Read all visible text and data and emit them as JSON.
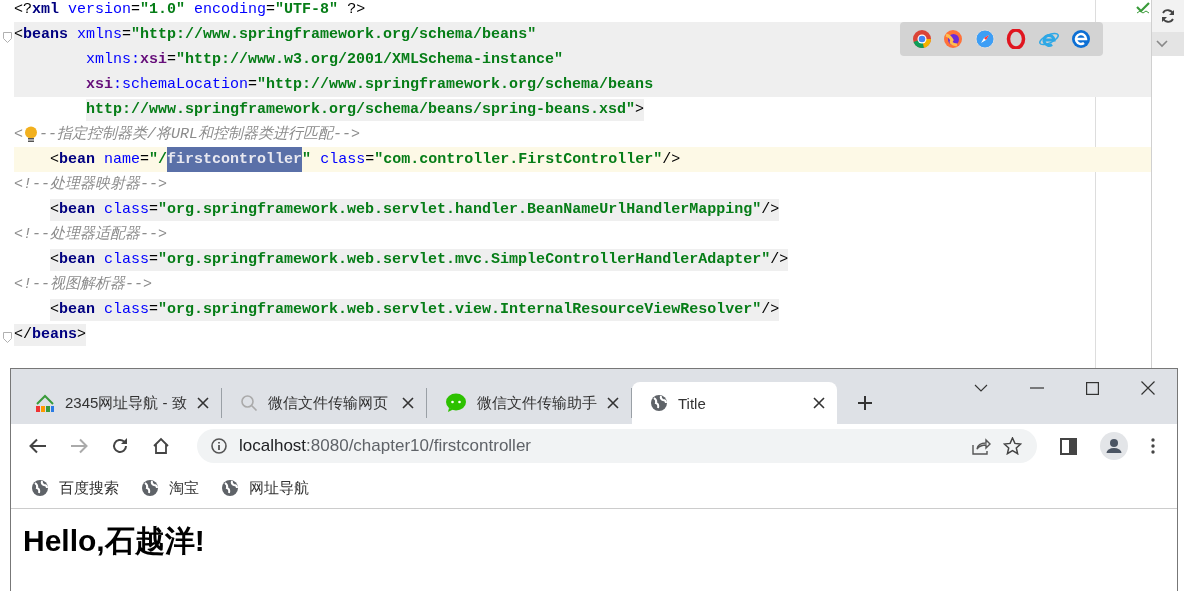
{
  "editor": {
    "lines": [
      {
        "kind": "plain",
        "fold": false,
        "tokens": [
          {
            "kind": "punct",
            "text": "<?"
          },
          {
            "kind": "tag",
            "text": "xml"
          },
          {
            "kind": "attr",
            "text": " version"
          },
          {
            "kind": "punct",
            "text": "="
          },
          {
            "kind": "value",
            "text": "\"1.0\""
          },
          {
            "kind": "attr",
            "text": " encoding"
          },
          {
            "kind": "punct",
            "text": "="
          },
          {
            "kind": "value",
            "text": "\"UTF-8\""
          },
          {
            "kind": "punct",
            "text": " ?>"
          }
        ]
      },
      {
        "kind": "block",
        "fold": true,
        "tokens": [
          {
            "kind": "punct",
            "text": "<"
          },
          {
            "kind": "tag",
            "text": "beans"
          },
          {
            "kind": "attr",
            "text": " xmlns"
          },
          {
            "kind": "punct",
            "text": "="
          },
          {
            "kind": "value",
            "text": "\"http://www.springframework.org/schema/beans\""
          }
        ]
      },
      {
        "kind": "block",
        "fold": false,
        "tokens": [
          {
            "kind": "attr",
            "text": "        xmlns:"
          },
          {
            "kind": "ns",
            "text": "xsi"
          },
          {
            "kind": "punct",
            "text": "="
          },
          {
            "kind": "value",
            "text": "\"http://www.w3.org/2001/XMLSchema-instance\""
          }
        ]
      },
      {
        "kind": "block",
        "fold": false,
        "tokens": [
          {
            "kind": "ns",
            "text": "        xsi"
          },
          {
            "kind": "attr",
            "text": ":schemaLocation"
          },
          {
            "kind": "punct",
            "text": "="
          },
          {
            "kind": "value",
            "text": "\"http://www.springframework.org/schema/beans"
          }
        ]
      },
      {
        "kind": "inline",
        "fold": false,
        "tokens": [
          {
            "kind": "value",
            "text": "        http://www.springframework.org/schema/beans/spring-beans.xsd\""
          },
          {
            "kind": "punct",
            "text": ">"
          }
        ]
      },
      {
        "kind": "plain",
        "fold": false,
        "tokens": [
          {
            "kind": "comment",
            "text": "<"
          },
          {
            "kind": "bulb"
          },
          {
            "kind": "comment",
            "text": "--指定控制器类/将URL和控制器类进行匹配-->"
          }
        ]
      },
      {
        "kind": "caret",
        "fold": false,
        "tokens": [
          {
            "kind": "punct",
            "text": "    <"
          },
          {
            "kind": "tag",
            "text": "bean"
          },
          {
            "kind": "attr",
            "text": " name"
          },
          {
            "kind": "punct",
            "text": "="
          },
          {
            "kind": "value",
            "text": "\"/"
          },
          {
            "kind": "selected",
            "text": "firstcontroller"
          },
          {
            "kind": "value",
            "text": "\""
          },
          {
            "kind": "attr",
            "text": " class"
          },
          {
            "kind": "punct",
            "text": "="
          },
          {
            "kind": "value",
            "text": "\"com.controller.FirstController\""
          },
          {
            "kind": "punct",
            "text": "/>"
          }
        ]
      },
      {
        "kind": "plain",
        "fold": false,
        "tokens": [
          {
            "kind": "comment",
            "text": "<!--处理器映射器-->"
          }
        ]
      },
      {
        "kind": "inline",
        "fold": false,
        "tokens": [
          {
            "kind": "punct",
            "text": "    <"
          },
          {
            "kind": "tag",
            "text": "bean"
          },
          {
            "kind": "attr",
            "text": " class"
          },
          {
            "kind": "punct",
            "text": "="
          },
          {
            "kind": "value",
            "text": "\"org.springframework.web.servlet.handler.BeanNameUrlHandlerMapping\""
          },
          {
            "kind": "punct",
            "text": "/>"
          }
        ]
      },
      {
        "kind": "plain",
        "fold": false,
        "tokens": [
          {
            "kind": "comment",
            "text": "<!--处理器适配器-->"
          }
        ]
      },
      {
        "kind": "inline",
        "fold": false,
        "tokens": [
          {
            "kind": "punct",
            "text": "    <"
          },
          {
            "kind": "tag",
            "text": "bean"
          },
          {
            "kind": "attr",
            "text": " class"
          },
          {
            "kind": "punct",
            "text": "="
          },
          {
            "kind": "value",
            "text": "\"org.springframework.web.servlet.mvc.SimpleControllerHandlerAdapter\""
          },
          {
            "kind": "punct",
            "text": "/>"
          }
        ]
      },
      {
        "kind": "plain",
        "fold": false,
        "tokens": [
          {
            "kind": "comment",
            "text": "<!--视图解析器-->"
          }
        ]
      },
      {
        "kind": "inline",
        "fold": false,
        "tokens": [
          {
            "kind": "punct",
            "text": "    <"
          },
          {
            "kind": "tag",
            "text": "bean"
          },
          {
            "kind": "attr",
            "text": " class"
          },
          {
            "kind": "punct",
            "text": "="
          },
          {
            "kind": "value",
            "text": "\"org.springframework.web.servlet.view.InternalResourceViewResolver\""
          },
          {
            "kind": "punct",
            "text": "/>"
          }
        ]
      },
      {
        "kind": "inline",
        "fold": true,
        "tokens": [
          {
            "kind": "punct",
            "text": "</"
          },
          {
            "kind": "tag",
            "text": "beans"
          },
          {
            "kind": "punct",
            "text": ">"
          }
        ]
      }
    ]
  },
  "browser": {
    "tabs": [
      {
        "title": "2345网址导航 - 致",
        "kind": "house",
        "selected": false
      },
      {
        "title": "微信文件传输网页",
        "kind": "search",
        "selected": false
      },
      {
        "title": "微信文件传输助手",
        "kind": "chat",
        "selected": false
      },
      {
        "title": "Title",
        "kind": "globe",
        "selected": true
      }
    ],
    "address": {
      "host": "localhost",
      "path": ":8080/chapter10/firstcontroller"
    },
    "bookmarks": [
      {
        "label": "百度搜索"
      },
      {
        "label": "淘宝"
      },
      {
        "label": "网址导航"
      }
    ],
    "page": {
      "heading": "Hello,石越洋!"
    }
  }
}
